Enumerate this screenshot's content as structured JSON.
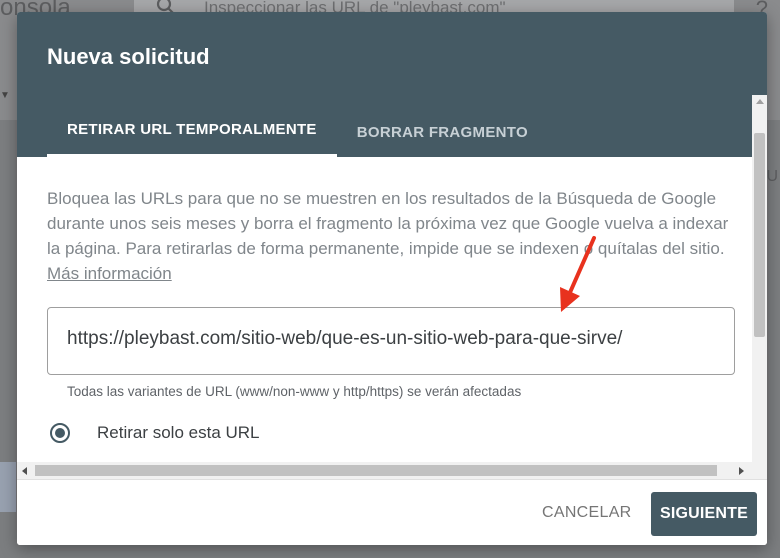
{
  "background": {
    "logo_text": "onsola",
    "search_text": "Inspeccionar las URL de \"pleybast.com\"",
    "right_letter": "U",
    "help_glyph": "?"
  },
  "dialog": {
    "title": "Nueva solicitud",
    "tabs": [
      {
        "label": "RETIRAR URL TEMPORALMENTE",
        "active": true
      },
      {
        "label": "BORRAR FRAGMENTO",
        "active": false
      }
    ],
    "description": "Bloquea las URLs para que no se muestren en los resultados de la Búsqueda de Google durante unos seis meses y borra el fragmento la próxima vez que Google vuelva a indexar la página. Para retirarlas de forma permanente, impide que se indexen o quítalas del sitio.",
    "more_info_link": "Más información",
    "url_value": "https://pleybast.com/sitio-web/que-es-un-sitio-web-para-que-sirve/",
    "url_helper": "Todas las variantes de URL (www/non-www y http/https) se verán afectadas",
    "radio_label": "Retirar solo esta URL",
    "cancel_label": "CANCELAR",
    "next_label": "SIGUIENTE"
  },
  "colors": {
    "header": "#455a64",
    "arrow": "#e8321e",
    "primary_button": "#455a64"
  },
  "icons": [
    "search-icon",
    "help-icon",
    "chevron-down-icon",
    "red-arrow-icon",
    "radio-selected-icon"
  ]
}
